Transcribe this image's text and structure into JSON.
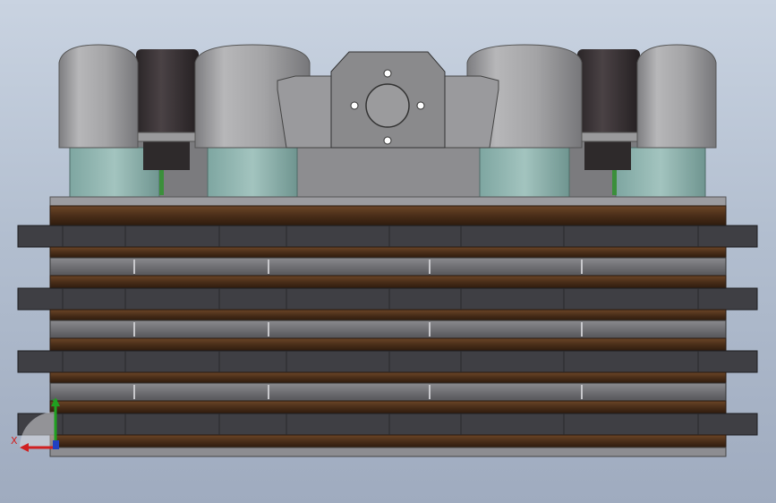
{
  "viewport": {
    "background_top": "#c9d3e1",
    "background_bottom": "#9fabbf"
  },
  "model": {
    "colors": {
      "canister": "#a9a9ab",
      "canister_dark": "#858587",
      "rubber": "#3a3436",
      "teal_housing": "#8fb5b0",
      "center_block": "#8a8a8c",
      "wood": "#5a3a22",
      "wood_dark": "#3b2414",
      "dark_plate": "#3f3f44",
      "gray_plate": "#6e6e72",
      "green_pin": "#3b8f3b"
    }
  },
  "triad": {
    "x_label": "X",
    "y_label": "Y",
    "x_color": "#d02020",
    "y_color": "#20a020"
  }
}
